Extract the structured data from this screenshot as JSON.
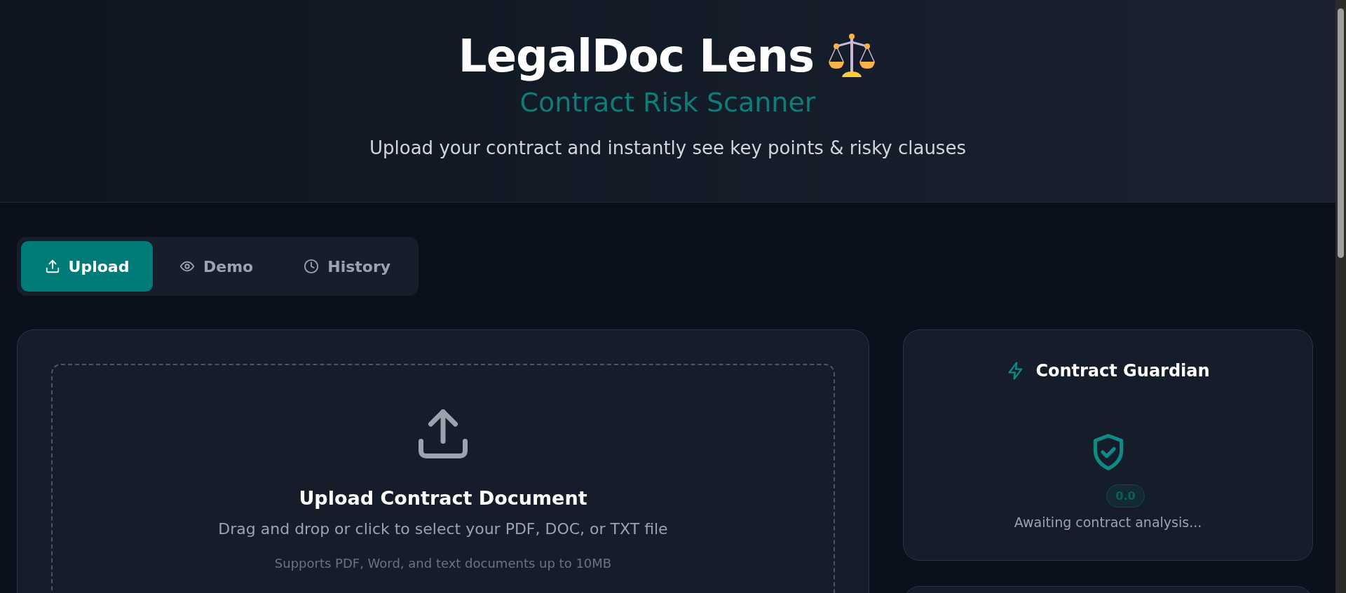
{
  "header": {
    "title": "LegalDoc Lens",
    "subtitle": "Contract Risk Scanner",
    "tagline": "Upload your contract and instantly see key points & risky clauses"
  },
  "tabs": [
    {
      "label": "Upload",
      "selected": true
    },
    {
      "label": "Demo",
      "selected": false
    },
    {
      "label": "History",
      "selected": false
    }
  ],
  "upload": {
    "title": "Upload Contract Document",
    "description": "Drag and drop or click to select your PDF, DOC, or TXT file",
    "note": "Supports PDF, Word, and text documents up to 10MB"
  },
  "guardian": {
    "title": "Contract Guardian",
    "score": "0.0",
    "status": "Awaiting contract analysis..."
  }
}
